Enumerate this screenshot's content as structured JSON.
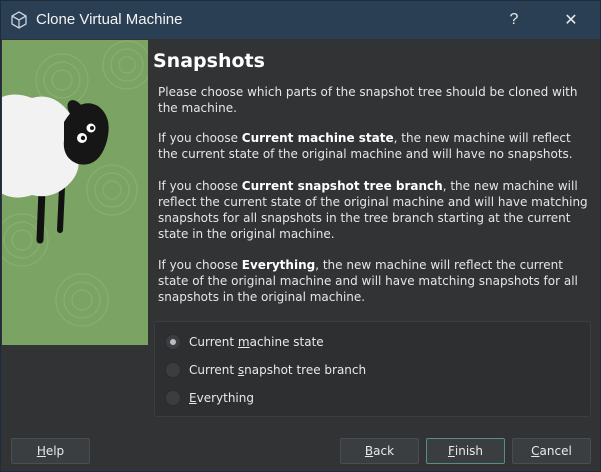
{
  "window": {
    "title": "Clone Virtual Machine",
    "help_glyph": "?",
    "close_glyph": "✕"
  },
  "page": {
    "heading": "Snapshots",
    "intro": "Please choose which parts of the snapshot tree should be cloned with the machine.",
    "p2_prefix": "If you choose ",
    "p2_bold": "Current machine state",
    "p2_suffix": ", the new machine will reflect the current state of the original machine and will have no snapshots.",
    "p3_prefix": "If you choose ",
    "p3_bold": "Current snapshot tree branch",
    "p3_suffix": ", the new machine will reflect the current state of the original machine and will have matching snapshots for all snapshots in the tree branch starting at the current state in the original machine.",
    "p4_prefix": "If you choose ",
    "p4_bold": "Everything",
    "p4_suffix": ", the new machine will reflect the current state of the original machine and will have matching snapshots for all snapshots in the original machine."
  },
  "options": {
    "current_state": {
      "pre": "Current ",
      "ul": "m",
      "post": "achine state",
      "selected": true
    },
    "branch": {
      "pre": "Current ",
      "ul": "s",
      "post": "napshot tree branch",
      "selected": false
    },
    "everything": {
      "pre": "",
      "ul": "E",
      "post": "verything",
      "selected": false
    }
  },
  "buttons": {
    "help": {
      "ul": "H",
      "post": "elp"
    },
    "back": {
      "ul": "B",
      "post": "ack"
    },
    "finish": {
      "ul": "F",
      "post": "inish"
    },
    "cancel": {
      "ul": "C",
      "post": "ancel"
    }
  },
  "colors": {
    "titlebar": "#2b3f54",
    "background": "#313335",
    "sidebar_green": "#7aa364",
    "accent_border": "#5a8a8a"
  },
  "icons": {
    "app": "virtualbox-cube-icon",
    "sheep": "sheep-illustration"
  }
}
